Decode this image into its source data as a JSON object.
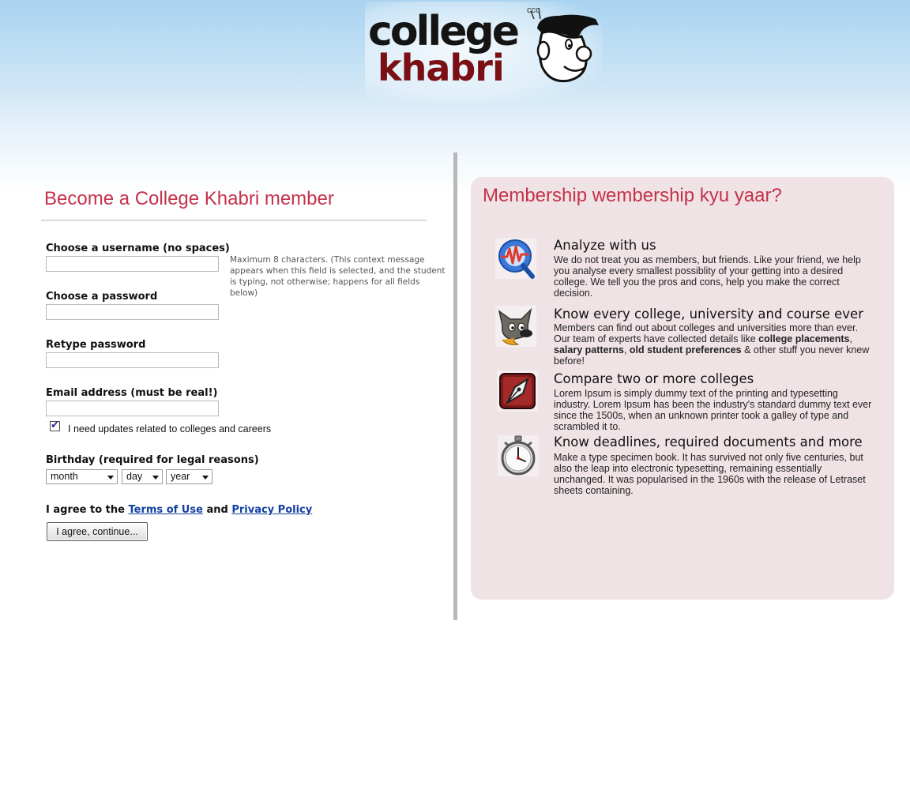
{
  "logo": {
    "word1": "college",
    "word2": "khabri",
    "sound": "ccc"
  },
  "form": {
    "title": "Become a College Khabri member",
    "username_label": "Choose a username (no spaces)",
    "username_hint": "Maximum 8 characters. (This context message appears when this field is selected, and the student is typing, not otherwise; happens for all fields below)",
    "password_label": "Choose a password",
    "retype_label": "Retype password",
    "email_label": "Email address (must be real!)",
    "updates_label": "I need updates related to colleges and careers",
    "updates_checked": true,
    "birthday_label": "Birthday (required for legal reasons)",
    "month": "month",
    "day": "day",
    "year": "year",
    "agree_prefix": "I agree to the",
    "terms_link": "Terms of Use",
    "agree_and": "and",
    "privacy_link": "Privacy Policy",
    "submit_label": "I agree, continue..."
  },
  "panel": {
    "title": "Membership wembership kyu yaar?",
    "features": [
      {
        "icon": "analyze-q-icon",
        "title": "Analyze with us",
        "desc": "We do not treat you as members, but friends. Like your friend, we help you analyse every smallest possiblity of your getting into a desired college. We tell you the pros and cons, help you make the correct decision."
      },
      {
        "icon": "wolf-mascot-icon",
        "title": "Know every college, university and course ever",
        "desc_a": "Members can find out about colleges and universities more than ever. Our team of experts have collected details like",
        "bold1": "college placements",
        "sep1": ",",
        "bold2": "salary patterns",
        "sep2": ",",
        "bold3": "old student preferences",
        "desc_b": "& other stuff you never knew before!"
      },
      {
        "icon": "pen-nib-icon",
        "title": "Compare two or more colleges",
        "desc": "Lorem Ipsum is simply dummy text of the printing and typesetting industry. Lorem Ipsum has been the industry's standard dummy text ever since the 1500s, when an unknown printer took a galley of type and scrambled it to."
      },
      {
        "icon": "stopwatch-icon",
        "title": "Know deadlines, required documents and more",
        "desc": "Make a type specimen book. It has survived not only five centuries, but also the leap into electronic typesetting, remaining essentially unchanged. It was popularised in the 1960s with the release of Letraset sheets containing."
      }
    ]
  },
  "colors": {
    "accent": "#c4324b",
    "panel_bg": "#f0e3e5",
    "link": "#1440a0",
    "logo_red": "#7a1014"
  }
}
